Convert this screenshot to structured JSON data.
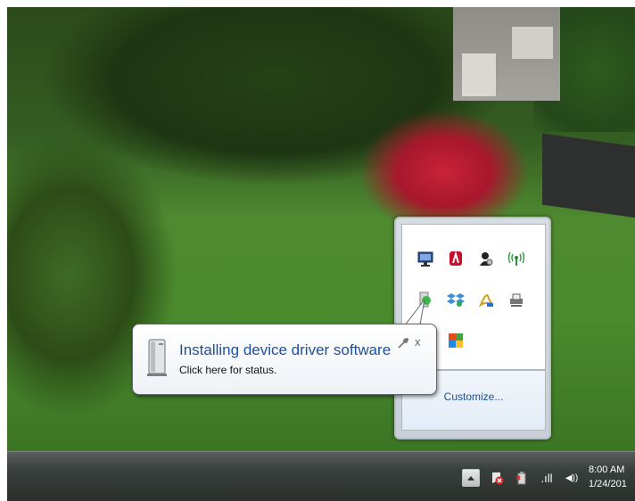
{
  "balloon": {
    "title": "Installing device driver software",
    "text": "Click here for status.",
    "options_icon": "wrench-icon",
    "close_label": "x"
  },
  "overflow": {
    "icons": [
      "monitor-icon",
      "adobe-icon",
      "network-user-icon",
      "wireless-icon",
      "usb-device-icon",
      "dropbox-icon",
      "acrobat-icon",
      "printer-icon",
      "",
      "apps-icon"
    ],
    "customize_label": "Customize..."
  },
  "taskbar": {
    "show_hidden_icon": "up-arrow-icon",
    "tray_icons": [
      "action-center-icon",
      "power-icon",
      "signal-icon",
      "volume-icon"
    ],
    "signal_text": ".ıll",
    "volume_text": "◀))",
    "time": "8:00 AM",
    "date": "1/24/201"
  }
}
